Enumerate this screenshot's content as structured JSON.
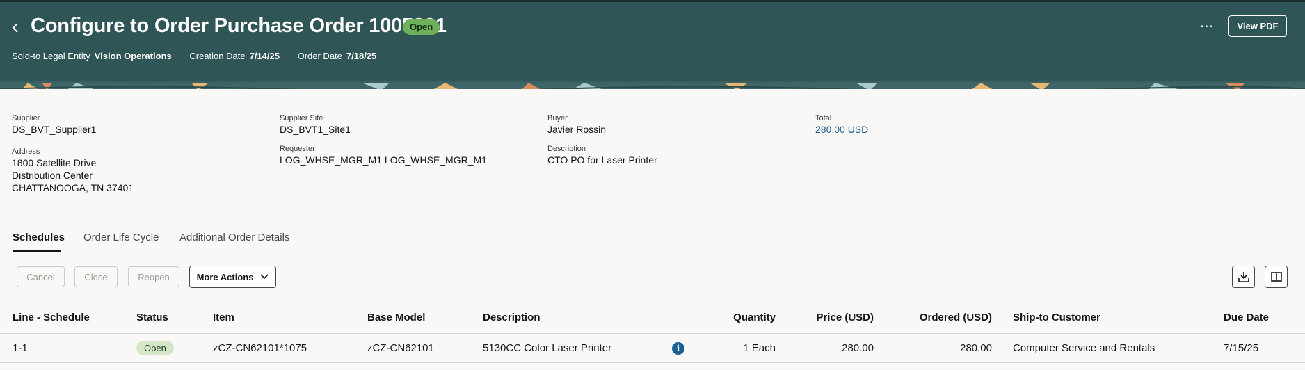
{
  "header": {
    "title": "Configure to Order Purchase Order 1005391",
    "status": "Open",
    "sold_to_label": "Sold-to Legal Entity",
    "sold_to_value": "Vision Operations",
    "creation_date_label": "Creation Date",
    "creation_date_value": "7/14/25",
    "order_date_label": "Order Date",
    "order_date_value": "7/18/25",
    "more_icon": "ellipsis-icon",
    "view_pdf_label": "View PDF",
    "back_icon": "chevron-left-icon"
  },
  "details": {
    "supplier_label": "Supplier",
    "supplier_value": "DS_BVT_Supplier1",
    "address_label": "Address",
    "address_line1": "1800 Satellite Drive",
    "address_line2": "Distribution Center",
    "address_line3": "CHATTANOOGA, TN 37401",
    "supplier_site_label": "Supplier Site",
    "supplier_site_value": "DS_BVT1_Site1",
    "requester_label": "Requester",
    "requester_value": "LOG_WHSE_MGR_M1 LOG_WHSE_MGR_M1",
    "buyer_label": "Buyer",
    "buyer_value": "Javier Rossin",
    "description_label": "Description",
    "description_value": "CTO PO for Laser Printer",
    "total_label": "Total",
    "total_value": "280.00 USD"
  },
  "tabs": [
    {
      "label": "Schedules",
      "active": true
    },
    {
      "label": "Order Life Cycle",
      "active": false
    },
    {
      "label": "Additional Order Details",
      "active": false
    }
  ],
  "toolbar": {
    "cancel_label": "Cancel",
    "close_label": "Close",
    "reopen_label": "Reopen",
    "more_actions_label": "More Actions",
    "download_icon": "download-icon",
    "columns_icon": "columns-icon"
  },
  "table": {
    "columns": [
      "Line - Schedule",
      "Status",
      "Item",
      "Base Model",
      "Description",
      "Quantity",
      "Price (USD)",
      "Ordered (USD)",
      "Ship-to Customer",
      "Due Date"
    ],
    "rows": [
      {
        "line_schedule": "1-1",
        "status": "Open",
        "item": "zCZ-CN62101*1075",
        "base_model": "zCZ-CN62101",
        "description": "5130CC Color Laser Printer",
        "quantity": "1 Each",
        "price": "280.00",
        "ordered": "280.00",
        "ship_to_customer": "Computer Service and Rentals",
        "due_date": "7/15/25"
      }
    ]
  },
  "colors": {
    "header_bg": "#2f5557",
    "link": "#1b6191",
    "status_pill": "#6fb15a"
  }
}
